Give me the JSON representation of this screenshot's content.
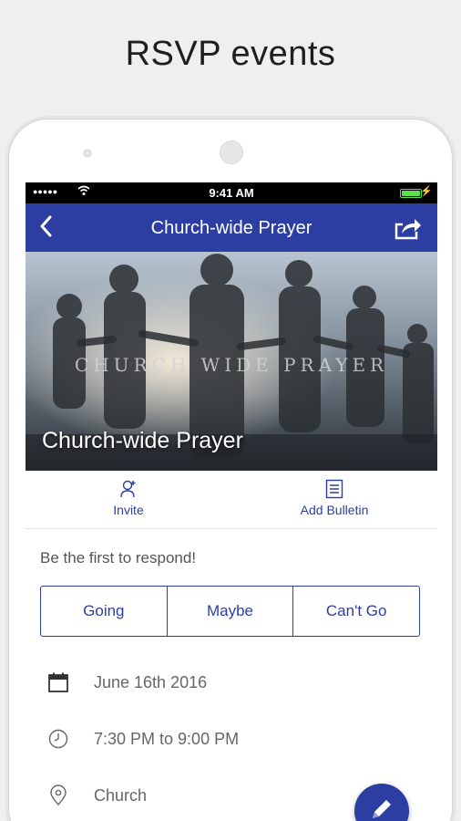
{
  "promo": {
    "title": "RSVP events"
  },
  "status_bar": {
    "time": "9:41 AM"
  },
  "nav": {
    "title": "Church-wide Prayer"
  },
  "hero": {
    "banner_text": "CHURCH WIDE PRAYER",
    "title": "Church-wide Prayer"
  },
  "actions": [
    {
      "label": "Invite",
      "icon": "add-person-icon"
    },
    {
      "label": "Add Bulletin",
      "icon": "bulletin-icon"
    }
  ],
  "respond_prompt": "Be the first to respond!",
  "rsvp_options": [
    "Going",
    "Maybe",
    "Can't Go"
  ],
  "details": {
    "date": "June 16th 2016",
    "time": "7:30 PM to 9:00 PM",
    "location": "Church"
  },
  "colors": {
    "accent": "#2d3ea3"
  }
}
